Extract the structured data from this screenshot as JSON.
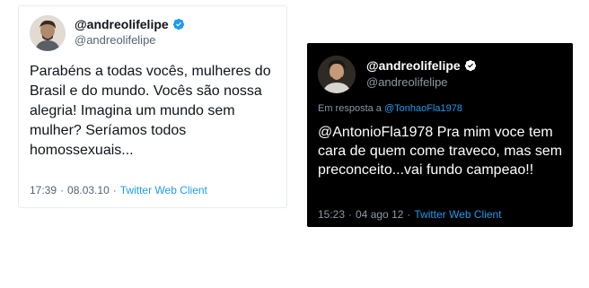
{
  "light_tweet": {
    "username": "@andreolifelipe",
    "handle": "@andreolifelipe",
    "text": "Parabéns a todas vocês, mulheres do Brasil e do mundo. Vocês são nossa alegria! Imagina um mundo sem mulher? Seríamos todos homossexuais...",
    "time": "17:39",
    "separator": "·",
    "date": "08.03.10",
    "client_separator": "·",
    "client": "Twitter Web Client"
  },
  "dark_tweet": {
    "username": "@andreolifelipe",
    "handle": "@andreolifelipe",
    "reply_prefix": "Em resposta a",
    "reply_to": "@TonhaoFla1978",
    "text": "@AntonioFla1978 Pra mim voce tem cara de quem come traveco, mas sem preconceito...vai fundo campeao!!",
    "time": "15:23",
    "separator": "·",
    "date": "04 ago 12",
    "client_separator": "·",
    "client": "Twitter Web Client"
  },
  "colors": {
    "accent": "#1d9bf0",
    "light_background": "#ffffff",
    "dark_background": "#000000"
  },
  "icons": {
    "verified": "verified-badge-icon",
    "avatar": "profile-photo"
  }
}
